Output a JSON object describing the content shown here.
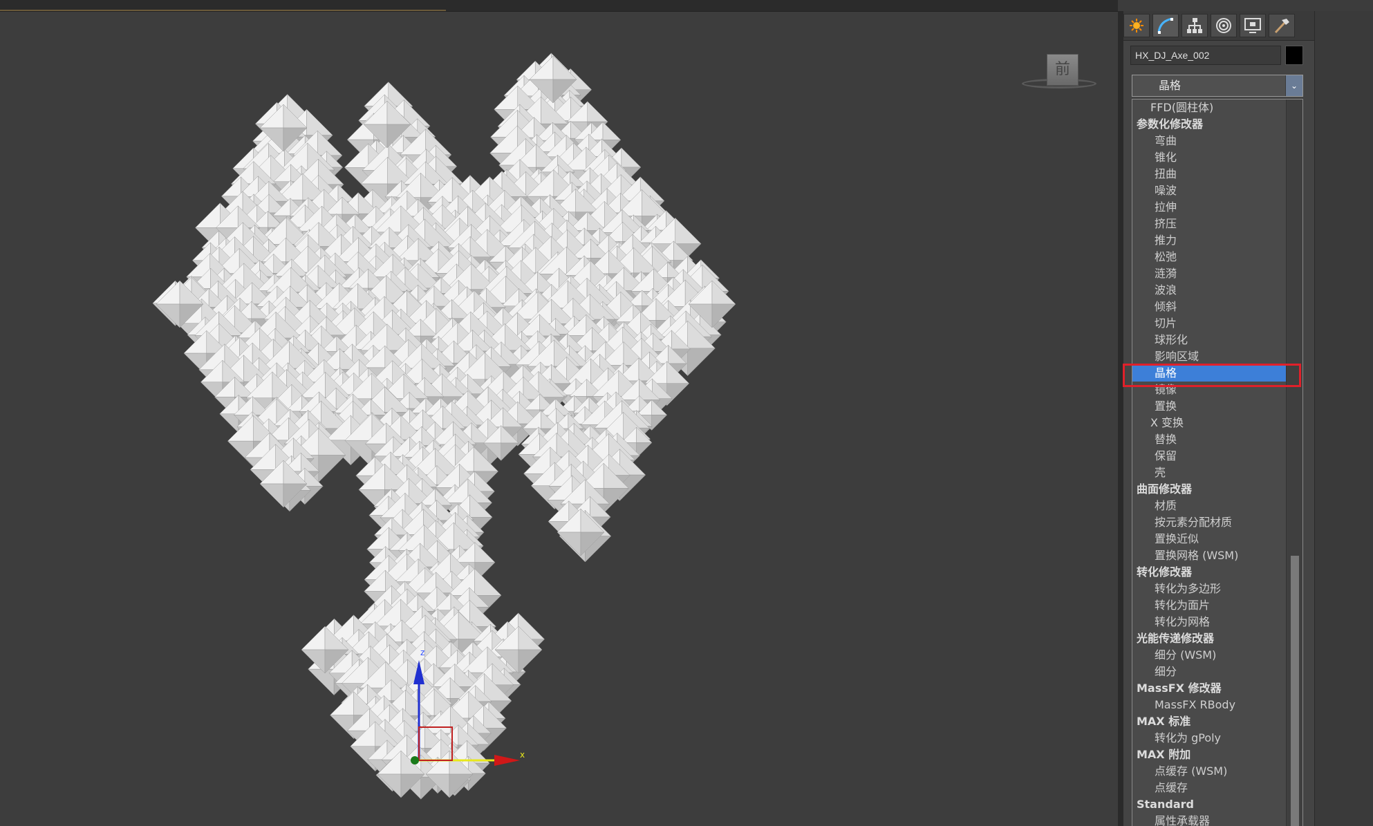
{
  "object": {
    "name": "HX_DJ_Axe_002",
    "color": "#000000"
  },
  "dropdown": {
    "selected": "晶格",
    "arrow": "⌄"
  },
  "viewcube": {
    "face_label": "前"
  },
  "axes": {
    "z": "z",
    "x": "x"
  },
  "modifier_list": [
    {
      "label": "FFD(圆柱体)",
      "kind": "first"
    },
    {
      "label": "参数化修改器",
      "kind": "cat"
    },
    {
      "label": "弯曲",
      "kind": "item"
    },
    {
      "label": "锥化",
      "kind": "item"
    },
    {
      "label": "扭曲",
      "kind": "item"
    },
    {
      "label": "噪波",
      "kind": "item"
    },
    {
      "label": "拉伸",
      "kind": "item"
    },
    {
      "label": "挤压",
      "kind": "item"
    },
    {
      "label": "推力",
      "kind": "item"
    },
    {
      "label": "松弛",
      "kind": "item"
    },
    {
      "label": "涟漪",
      "kind": "item"
    },
    {
      "label": "波浪",
      "kind": "item"
    },
    {
      "label": "倾斜",
      "kind": "item"
    },
    {
      "label": "切片",
      "kind": "item"
    },
    {
      "label": "球形化",
      "kind": "item"
    },
    {
      "label": "影响区域",
      "kind": "item"
    },
    {
      "label": "晶格",
      "kind": "item",
      "selected": true
    },
    {
      "label": "镜像",
      "kind": "item"
    },
    {
      "label": "置换",
      "kind": "item"
    },
    {
      "label": "X 变换",
      "kind": "xform"
    },
    {
      "label": "替换",
      "kind": "item"
    },
    {
      "label": "保留",
      "kind": "item"
    },
    {
      "label": "壳",
      "kind": "item"
    },
    {
      "label": "曲面修改器",
      "kind": "cat"
    },
    {
      "label": "材质",
      "kind": "item"
    },
    {
      "label": "按元素分配材质",
      "kind": "item"
    },
    {
      "label": "置换近似",
      "kind": "item"
    },
    {
      "label": "置换网格 (WSM)",
      "kind": "item"
    },
    {
      "label": "转化修改器",
      "kind": "cat"
    },
    {
      "label": "转化为多边形",
      "kind": "item"
    },
    {
      "label": "转化为面片",
      "kind": "item"
    },
    {
      "label": "转化为网格",
      "kind": "item"
    },
    {
      "label": "光能传递修改器",
      "kind": "cat"
    },
    {
      "label": "细分 (WSM)",
      "kind": "item"
    },
    {
      "label": "细分",
      "kind": "item"
    },
    {
      "label": "MassFX 修改器",
      "kind": "cat"
    },
    {
      "label": "MassFX RBody",
      "kind": "item"
    },
    {
      "label": "MAX 标准",
      "kind": "cat"
    },
    {
      "label": "转化为 gPoly",
      "kind": "item"
    },
    {
      "label": "MAX 附加",
      "kind": "cat"
    },
    {
      "label": "点缓存 (WSM)",
      "kind": "item"
    },
    {
      "label": "点缓存",
      "kind": "item"
    },
    {
      "label": "Standard",
      "kind": "cat"
    },
    {
      "label": "属性承载器",
      "kind": "item"
    }
  ],
  "panel_tabs": [
    {
      "icon": "create-icon"
    },
    {
      "icon": "modify-icon"
    },
    {
      "icon": "hierarchy-icon"
    },
    {
      "icon": "motion-icon"
    },
    {
      "icon": "display-icon"
    },
    {
      "icon": "utilities-icon"
    }
  ],
  "colors": {
    "selection": "#3d7fd8",
    "highlight_box": "#e0202a"
  }
}
